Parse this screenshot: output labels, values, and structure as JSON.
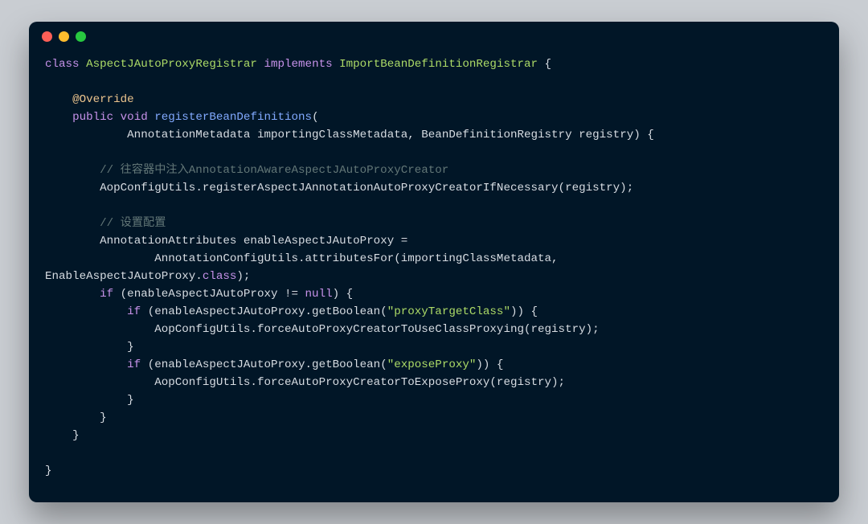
{
  "code": {
    "l1": {
      "kw_class": "class",
      "type1": "AspectJAutoProxyRegistrar",
      "kw_impl": "implements",
      "type2": "ImportBeanDefinitionRegistrar",
      "brace": " {"
    },
    "l3": {
      "ann": "@Override"
    },
    "l4": {
      "kw_pub": "public",
      "kw_void": "void",
      "mtd": "registerBeanDefinitions",
      "paren": "("
    },
    "l5": {
      "type1": "AnnotationMetadata",
      "arg1": "importingClassMetadata",
      "comma": ", ",
      "type2": "BeanDefinitionRegistry",
      "arg2": "registry",
      "close": ") {"
    },
    "l7": {
      "cmt": "// 往容器中注入AnnotationAwareAspectJAutoProxyCreator"
    },
    "l8": {
      "a": "AopConfigUtils.registerAspectJAnnotationAutoProxyCreatorIfNecessary(registry);"
    },
    "l10": {
      "cmt": "// 设置配置"
    },
    "l11": {
      "a": "AnnotationAttributes enableAspectJAutoProxy ="
    },
    "l12": {
      "a": "AnnotationConfigUtils.attributesFor(importingClassMetadata, "
    },
    "l13": {
      "a": "EnableAspectJAutoProxy.",
      "kw_class": "class",
      "b": ");"
    },
    "l14": {
      "kw_if": "if",
      "a": " (enableAspectJAutoProxy != ",
      "kw_null": "null",
      "b": ") {"
    },
    "l15": {
      "kw_if": "if",
      "a": " (enableAspectJAutoProxy.getBoolean(",
      "str": "\"proxyTargetClass\"",
      "b": ")) {"
    },
    "l16": {
      "a": "AopConfigUtils.forceAutoProxyCreatorToUseClassProxying(registry);"
    },
    "l17": {
      "a": "}"
    },
    "l18": {
      "kw_if": "if",
      "a": " (enableAspectJAutoProxy.getBoolean(",
      "str": "\"exposeProxy\"",
      "b": ")) {"
    },
    "l19": {
      "a": "AopConfigUtils.forceAutoProxyCreatorToExposeProxy(registry);"
    },
    "l20": {
      "a": "}"
    },
    "l21": {
      "a": "}"
    },
    "l22": {
      "a": "}"
    },
    "l24": {
      "a": "}"
    }
  }
}
